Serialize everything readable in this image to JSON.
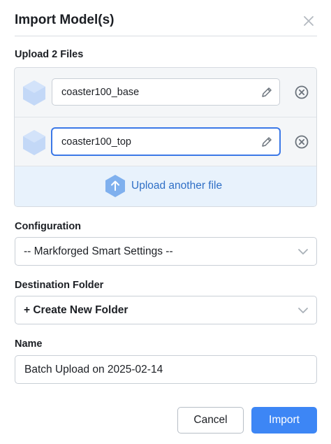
{
  "dialog": {
    "title": "Import Model(s)",
    "upload_label": "Upload 2 Files",
    "files": [
      {
        "name": "coaster100_base",
        "focused": false
      },
      {
        "name": "coaster100_top",
        "focused": true
      }
    ],
    "upload_another_label": "Upload another file",
    "configuration_label": "Configuration",
    "configuration_value": "-- Markforged Smart Settings --",
    "destination_label": "Destination Folder",
    "destination_value": "+ Create New Folder",
    "name_label": "Name",
    "name_value": "Batch Upload on 2025-02-14",
    "cancel_label": "Cancel",
    "import_label": "Import"
  },
  "colors": {
    "primary": "#3d86f5",
    "link": "#2f6fc6",
    "upload_bg": "#e8f2fc",
    "hex_icon": "#c3d8f7"
  }
}
